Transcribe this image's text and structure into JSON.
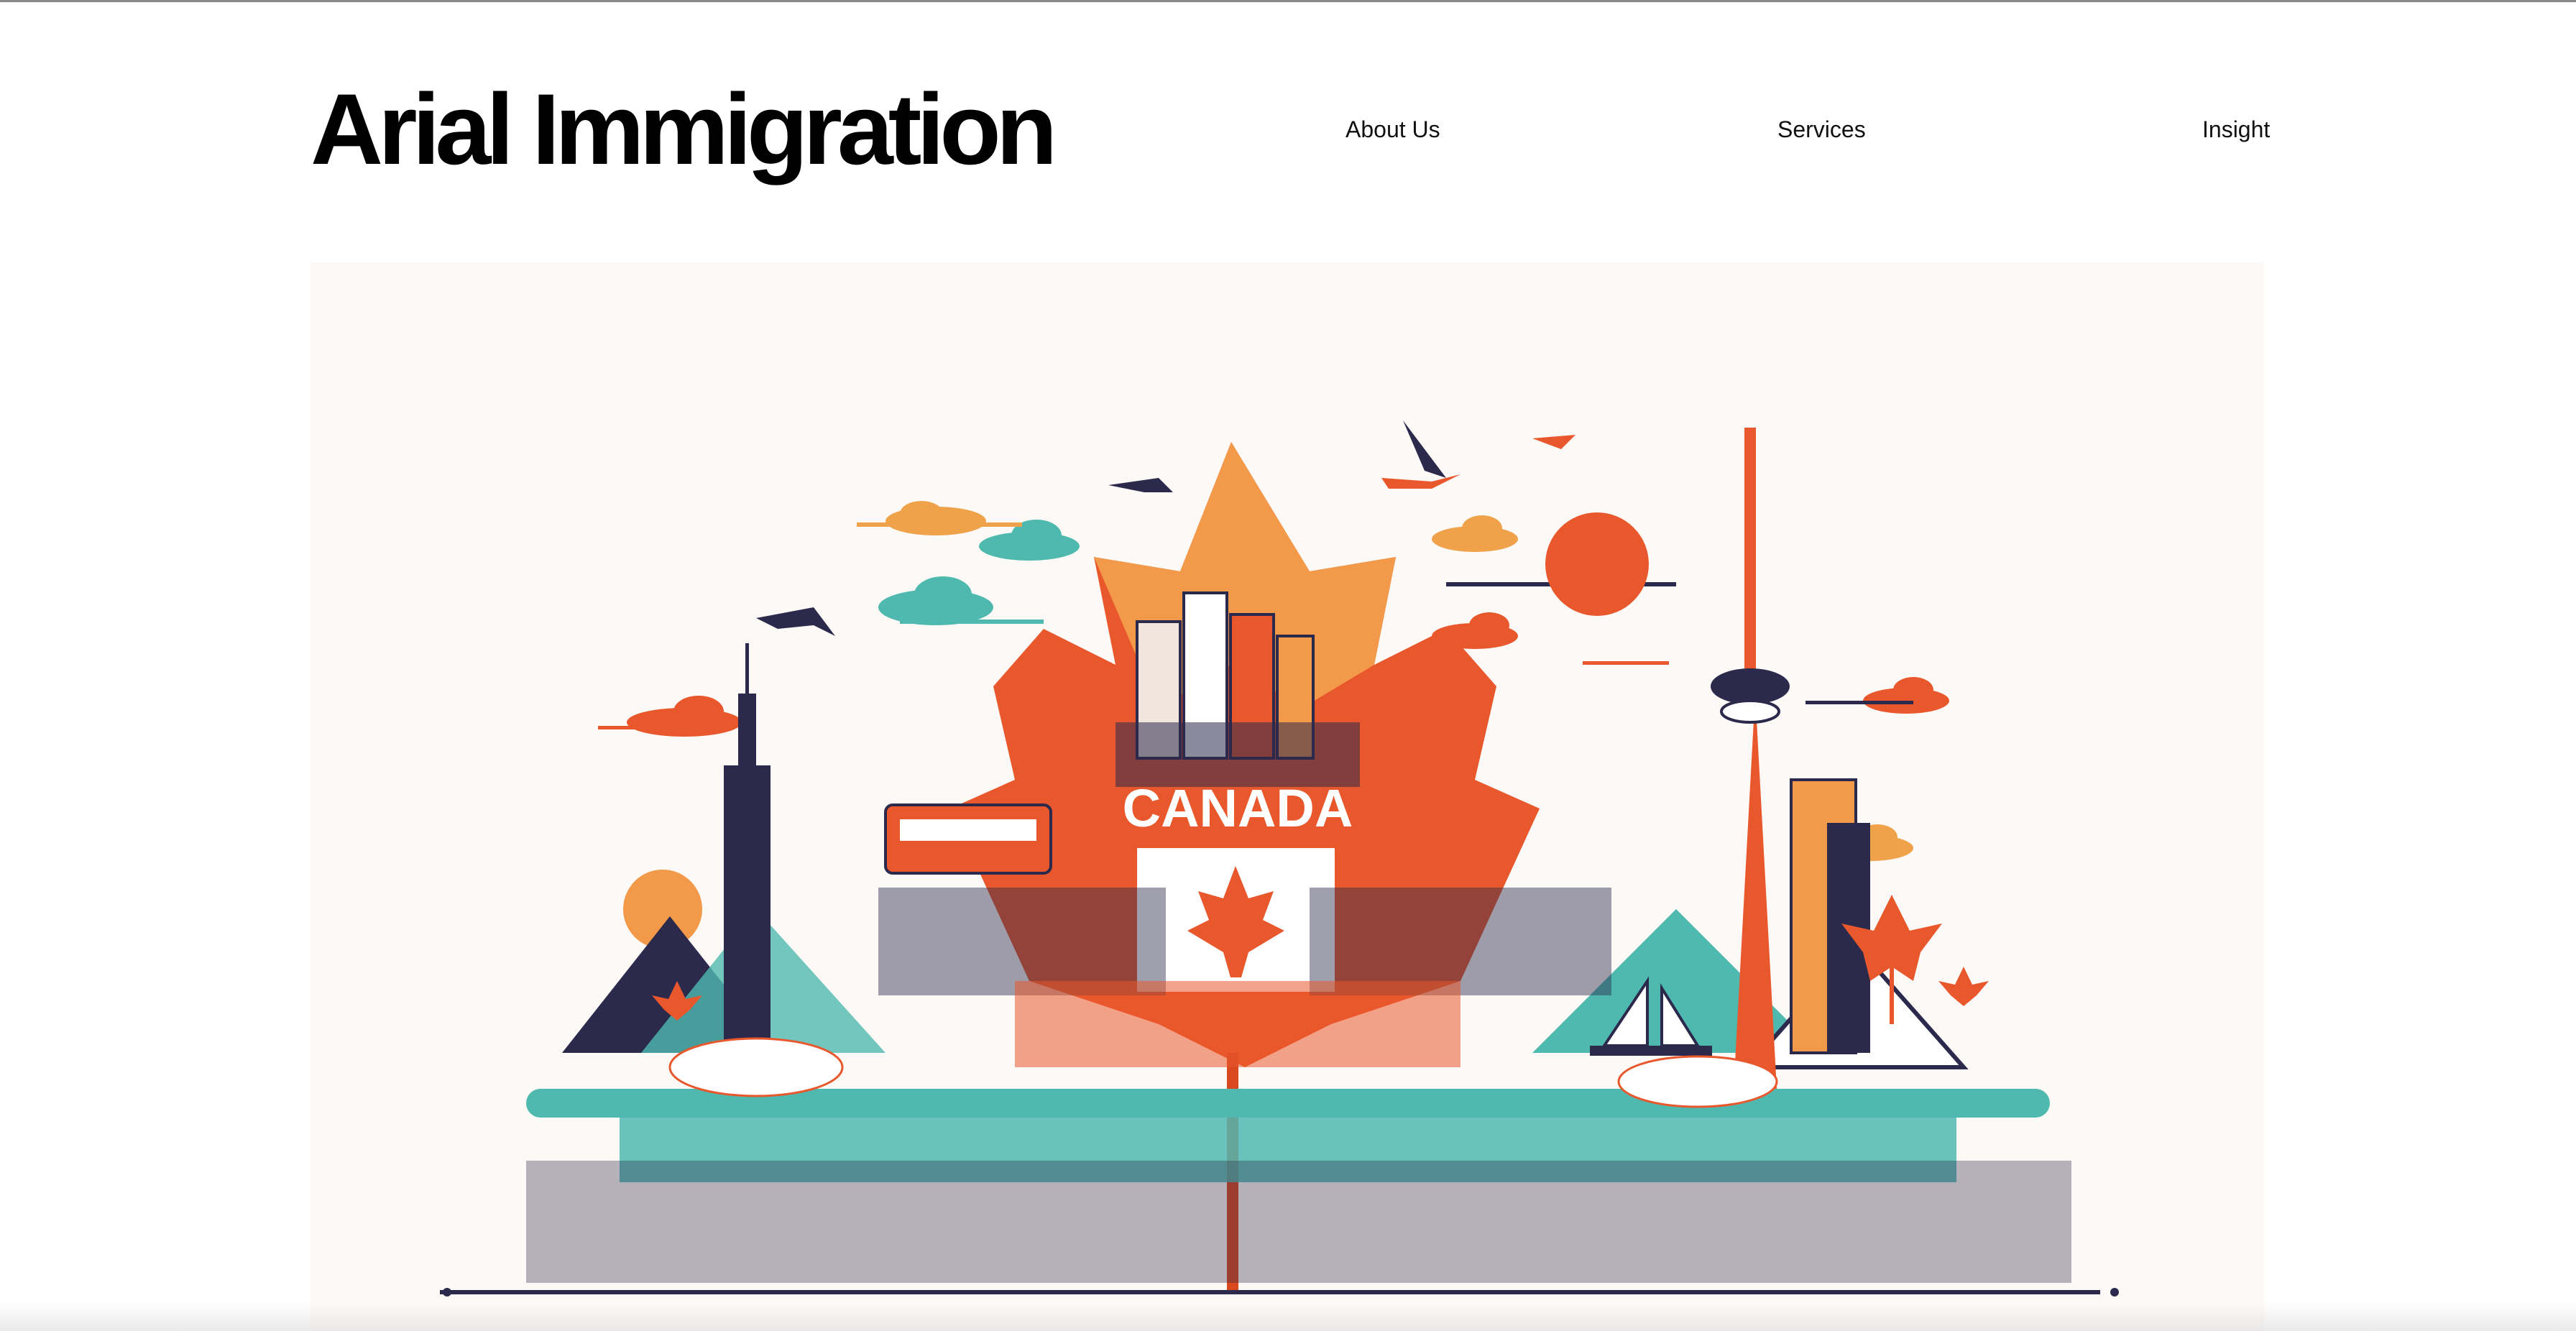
{
  "brand": {
    "name": "Arial Immigration"
  },
  "nav": {
    "items": [
      {
        "label": "About Us"
      },
      {
        "label": "Services"
      },
      {
        "label": "Insight"
      }
    ]
  },
  "hero": {
    "banner_text": "CANADA",
    "icons": [
      "maple-leaf-icon",
      "cn-tower-icon",
      "skyscraper-icon",
      "bird-icon",
      "sun-icon",
      "cloud-icon",
      "mountain-icon",
      "sailboat-icon",
      "train-icon"
    ]
  },
  "colors": {
    "leaf_orange": "#e9582c",
    "leaf_light": "#f39a4a",
    "navy": "#2b2a4c",
    "teal": "#4fb9b0",
    "cream": "#fdf9f6"
  }
}
